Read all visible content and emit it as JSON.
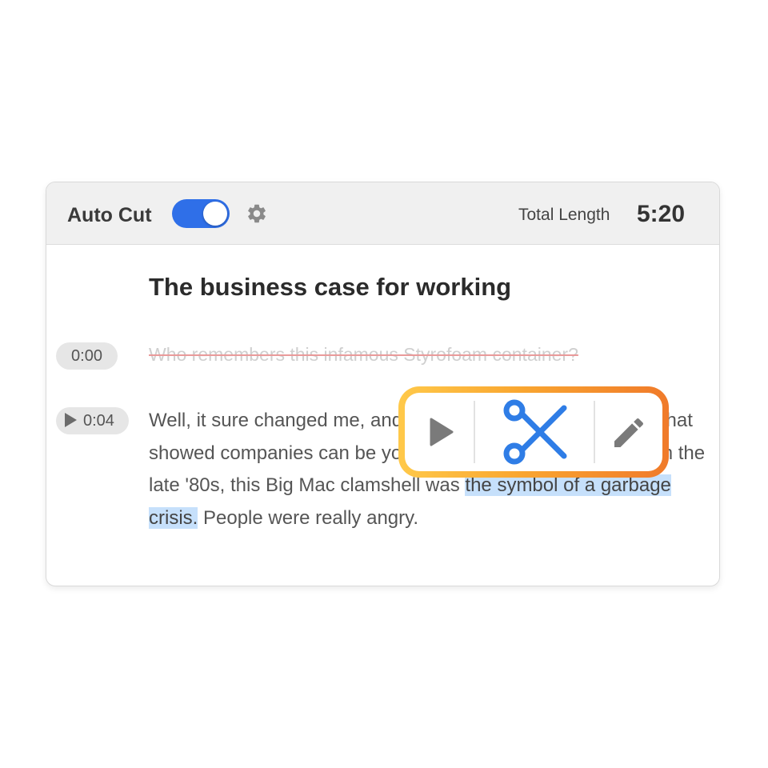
{
  "toolbar": {
    "auto_cut_label": "Auto Cut",
    "auto_cut_on": true,
    "total_length_label": "Total Length",
    "total_length_value": "5:20"
  },
  "transcript": {
    "title": "The business case for working",
    "segments": [
      {
        "timestamp": "0:00",
        "text": "Who remembers this infamous Styrofoam container?",
        "struck": true
      },
      {
        "timestamp": "0:04",
        "text_before": "Well, it sure changed me, and it started a revelatory journey that showed companies can be your best allies. You know, back in the late '80s, this Big Mac clamshell was ",
        "highlighted": "the symbol of a garbage crisis.",
        "text_after": " People were really angry."
      }
    ]
  },
  "popup_actions": [
    "play-icon",
    "scissors-icon",
    "pencil-icon"
  ],
  "colors": {
    "accent": "#2f6fe8",
    "scissors": "#2f7de6",
    "highlight": "#c6e0fb",
    "strike": "#e99a9a",
    "popup_gradient_start": "#ffc94a",
    "popup_gradient_end": "#f07a2a"
  }
}
